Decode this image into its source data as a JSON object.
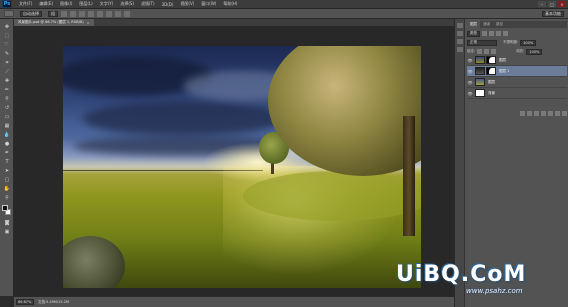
{
  "app": {
    "logo_text": "Ps"
  },
  "menubar": {
    "items": [
      "文件(F)",
      "编辑(E)",
      "图像(I)",
      "图层(L)",
      "文字(Y)",
      "选择(S)",
      "滤镜(T)",
      "3D(D)",
      "视图(V)",
      "窗口(W)",
      "帮助(H)"
    ],
    "window_buttons": [
      "–",
      "□",
      "×"
    ]
  },
  "optionsbar": {
    "auto_select_label": "自动选择",
    "group_select": "组",
    "workspace": "基本功能"
  },
  "document": {
    "tab_label": "风景图片.psd @ 66.7% (图层 1, RGB/8)",
    "tab_close": "×"
  },
  "statusbar": {
    "zoom": "66.67%",
    "doc_info": "文档:5.49M/15.2M"
  },
  "layers_panel": {
    "tabs": [
      "图层",
      "通道",
      "路径"
    ],
    "kind_label": "类型",
    "blend_mode": "正常",
    "opacity_label": "不透明度:",
    "opacity_value": "100%",
    "lock_label": "锁定:",
    "fill_label": "填充:",
    "fill_value": "100%",
    "layers": [
      {
        "name": "图层",
        "visible": "👁",
        "selected": false,
        "has_mask": true
      },
      {
        "name": "图层 1",
        "visible": "👁",
        "selected": true,
        "has_mask": true
      },
      {
        "name": "图层",
        "visible": "👁",
        "selected": false,
        "has_mask": false
      },
      {
        "name": "背景",
        "visible": "👁",
        "selected": false,
        "has_mask": false
      }
    ]
  },
  "watermark": {
    "main": "UiBQ.CoM",
    "sub": "www.psahz.com"
  },
  "colors": {
    "ps_accent": "#31a8ff",
    "selected_layer": "#6c7d99"
  }
}
